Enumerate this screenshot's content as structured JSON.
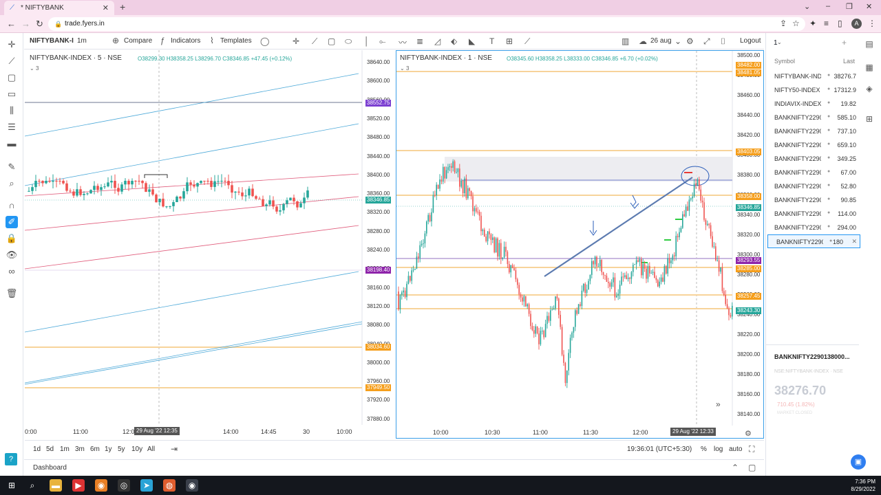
{
  "browser": {
    "tab_title": "* NIFTYBANK",
    "url": "trade.fyers.in",
    "avatar_letter": "A"
  },
  "toolbar": {
    "symbol": "NIFTYBANK-I",
    "interval": "1m",
    "compare": "Compare",
    "indicators": "Indicators",
    "templates": "Templates",
    "date_label": "26 aug",
    "logout": "Logout"
  },
  "left_chart": {
    "title": "NIFTYBANK-INDEX · 5 · NSE",
    "ohlc": "O38299.30 H38358.25 L38296.70 C38346.85 +47.45 (+0.12%)",
    "legend_count": "3",
    "price_axis": [
      "38640.00",
      "38600.00",
      "38560.00",
      "38520.00",
      "38480.00",
      "38440.00",
      "38400.00",
      "38360.00",
      "38320.00",
      "38280.00",
      "38240.00",
      "38200.00",
      "38160.00",
      "38120.00",
      "38080.00",
      "38040.00",
      "38000.00",
      "37960.00",
      "37920.00",
      "37880.00"
    ],
    "price_badges": [
      {
        "value": "38552.75",
        "color": "#7b3fd1"
      },
      {
        "value": "38346.85",
        "color": "#26a69a"
      },
      {
        "value": "38198.40",
        "color": "#8e24aa"
      },
      {
        "value": "38034.60",
        "color": "#f59e1b"
      },
      {
        "value": "37949.50",
        "color": "#f59e1b"
      }
    ],
    "time_axis": [
      "0:00",
      "11:00",
      "12:00",
      "14:00",
      "14:45",
      "30",
      "10:00"
    ],
    "cursor_time": "29 Aug '22  12:35"
  },
  "right_chart": {
    "title": "NIFTYBANK-INDEX · 1 · NSE",
    "ohlc": "O38345.60 H38358.25 L38333.00 C38346.85 +6.70 (+0.02%)",
    "legend_count": "3",
    "price_axis": [
      "38500.00",
      "38480.00",
      "38460.00",
      "38440.00",
      "38420.00",
      "38400.00",
      "38380.00",
      "38360.00",
      "38340.00",
      "38320.00",
      "38300.00",
      "38280.00",
      "38260.00",
      "38240.00",
      "38220.00",
      "38200.00",
      "38180.00",
      "38160.00",
      "38140.00"
    ],
    "price_badges": [
      {
        "value": "38482.00",
        "color": "#f59e1b"
      },
      {
        "value": "38481.05",
        "color": "#f59e1b"
      },
      {
        "value": "38403.05",
        "color": "#f59e1b"
      },
      {
        "value": "38358.00",
        "color": "#f59e1b"
      },
      {
        "value": "38346.85",
        "color": "#26a69a"
      },
      {
        "value": "38293.55",
        "color": "#8e24aa"
      },
      {
        "value": "38285.00",
        "color": "#f59e1b"
      },
      {
        "value": "38257.45",
        "color": "#f59e1b"
      },
      {
        "value": "38243.30",
        "color": "#26a69a"
      }
    ],
    "time_axis": [
      "10:00",
      "10:30",
      "11:00",
      "11:30",
      "12:00",
      "12:30"
    ],
    "cursor_time": "29 Aug '22  12:33"
  },
  "timeframes": [
    "1d",
    "5d",
    "1m",
    "3m",
    "6m",
    "1y",
    "5y",
    "10y",
    "All"
  ],
  "status": {
    "time": "19:36:01 (UTC+5:30)",
    "percent": "%",
    "log": "log",
    "auto": "auto"
  },
  "bottom": {
    "dashboard": "Dashboard"
  },
  "watchlist": {
    "name": "1",
    "col_symbol": "Symbol",
    "col_last": "Last",
    "rows": [
      {
        "symbol": "NIFTYBANK-INDEX",
        "last": "38276.7"
      },
      {
        "symbol": "NIFTY50-INDEX",
        "last": "17312.9"
      },
      {
        "symbol": "INDIAVIX-INDEX",
        "last": "19.82"
      },
      {
        "symbol": "BANKNIFTY2290",
        "last": "585.10"
      },
      {
        "symbol": "BANKNIFTY2290",
        "last": "737.10"
      },
      {
        "symbol": "BANKNIFTY2290",
        "last": "659.10"
      },
      {
        "symbol": "BANKNIFTY2290",
        "last": "349.25"
      },
      {
        "symbol": "BANKNIFTY2290",
        "last": "67.00"
      },
      {
        "symbol": "BANKNIFTY2290",
        "last": "52.80"
      },
      {
        "symbol": "BANKNIFTY2290",
        "last": "90.85"
      },
      {
        "symbol": "BANKNIFTY2290",
        "last": "114.00"
      },
      {
        "symbol": "BANKNIFTY2290",
        "last": "294.00"
      },
      {
        "symbol": "BANKNIFTY2290",
        "last": "180"
      }
    ],
    "detail_symbol": "BANKNIFTY2290138000...",
    "detail_sub": "NSE:NIFTYBANK-INDEX · NSE",
    "detail_price": "38276.70",
    "detail_change": "710.45 (1.82%)",
    "detail_status": "MARKET CLOSED"
  },
  "taskbar": {
    "time": "7:36 PM",
    "date": "8/29/2022"
  }
}
